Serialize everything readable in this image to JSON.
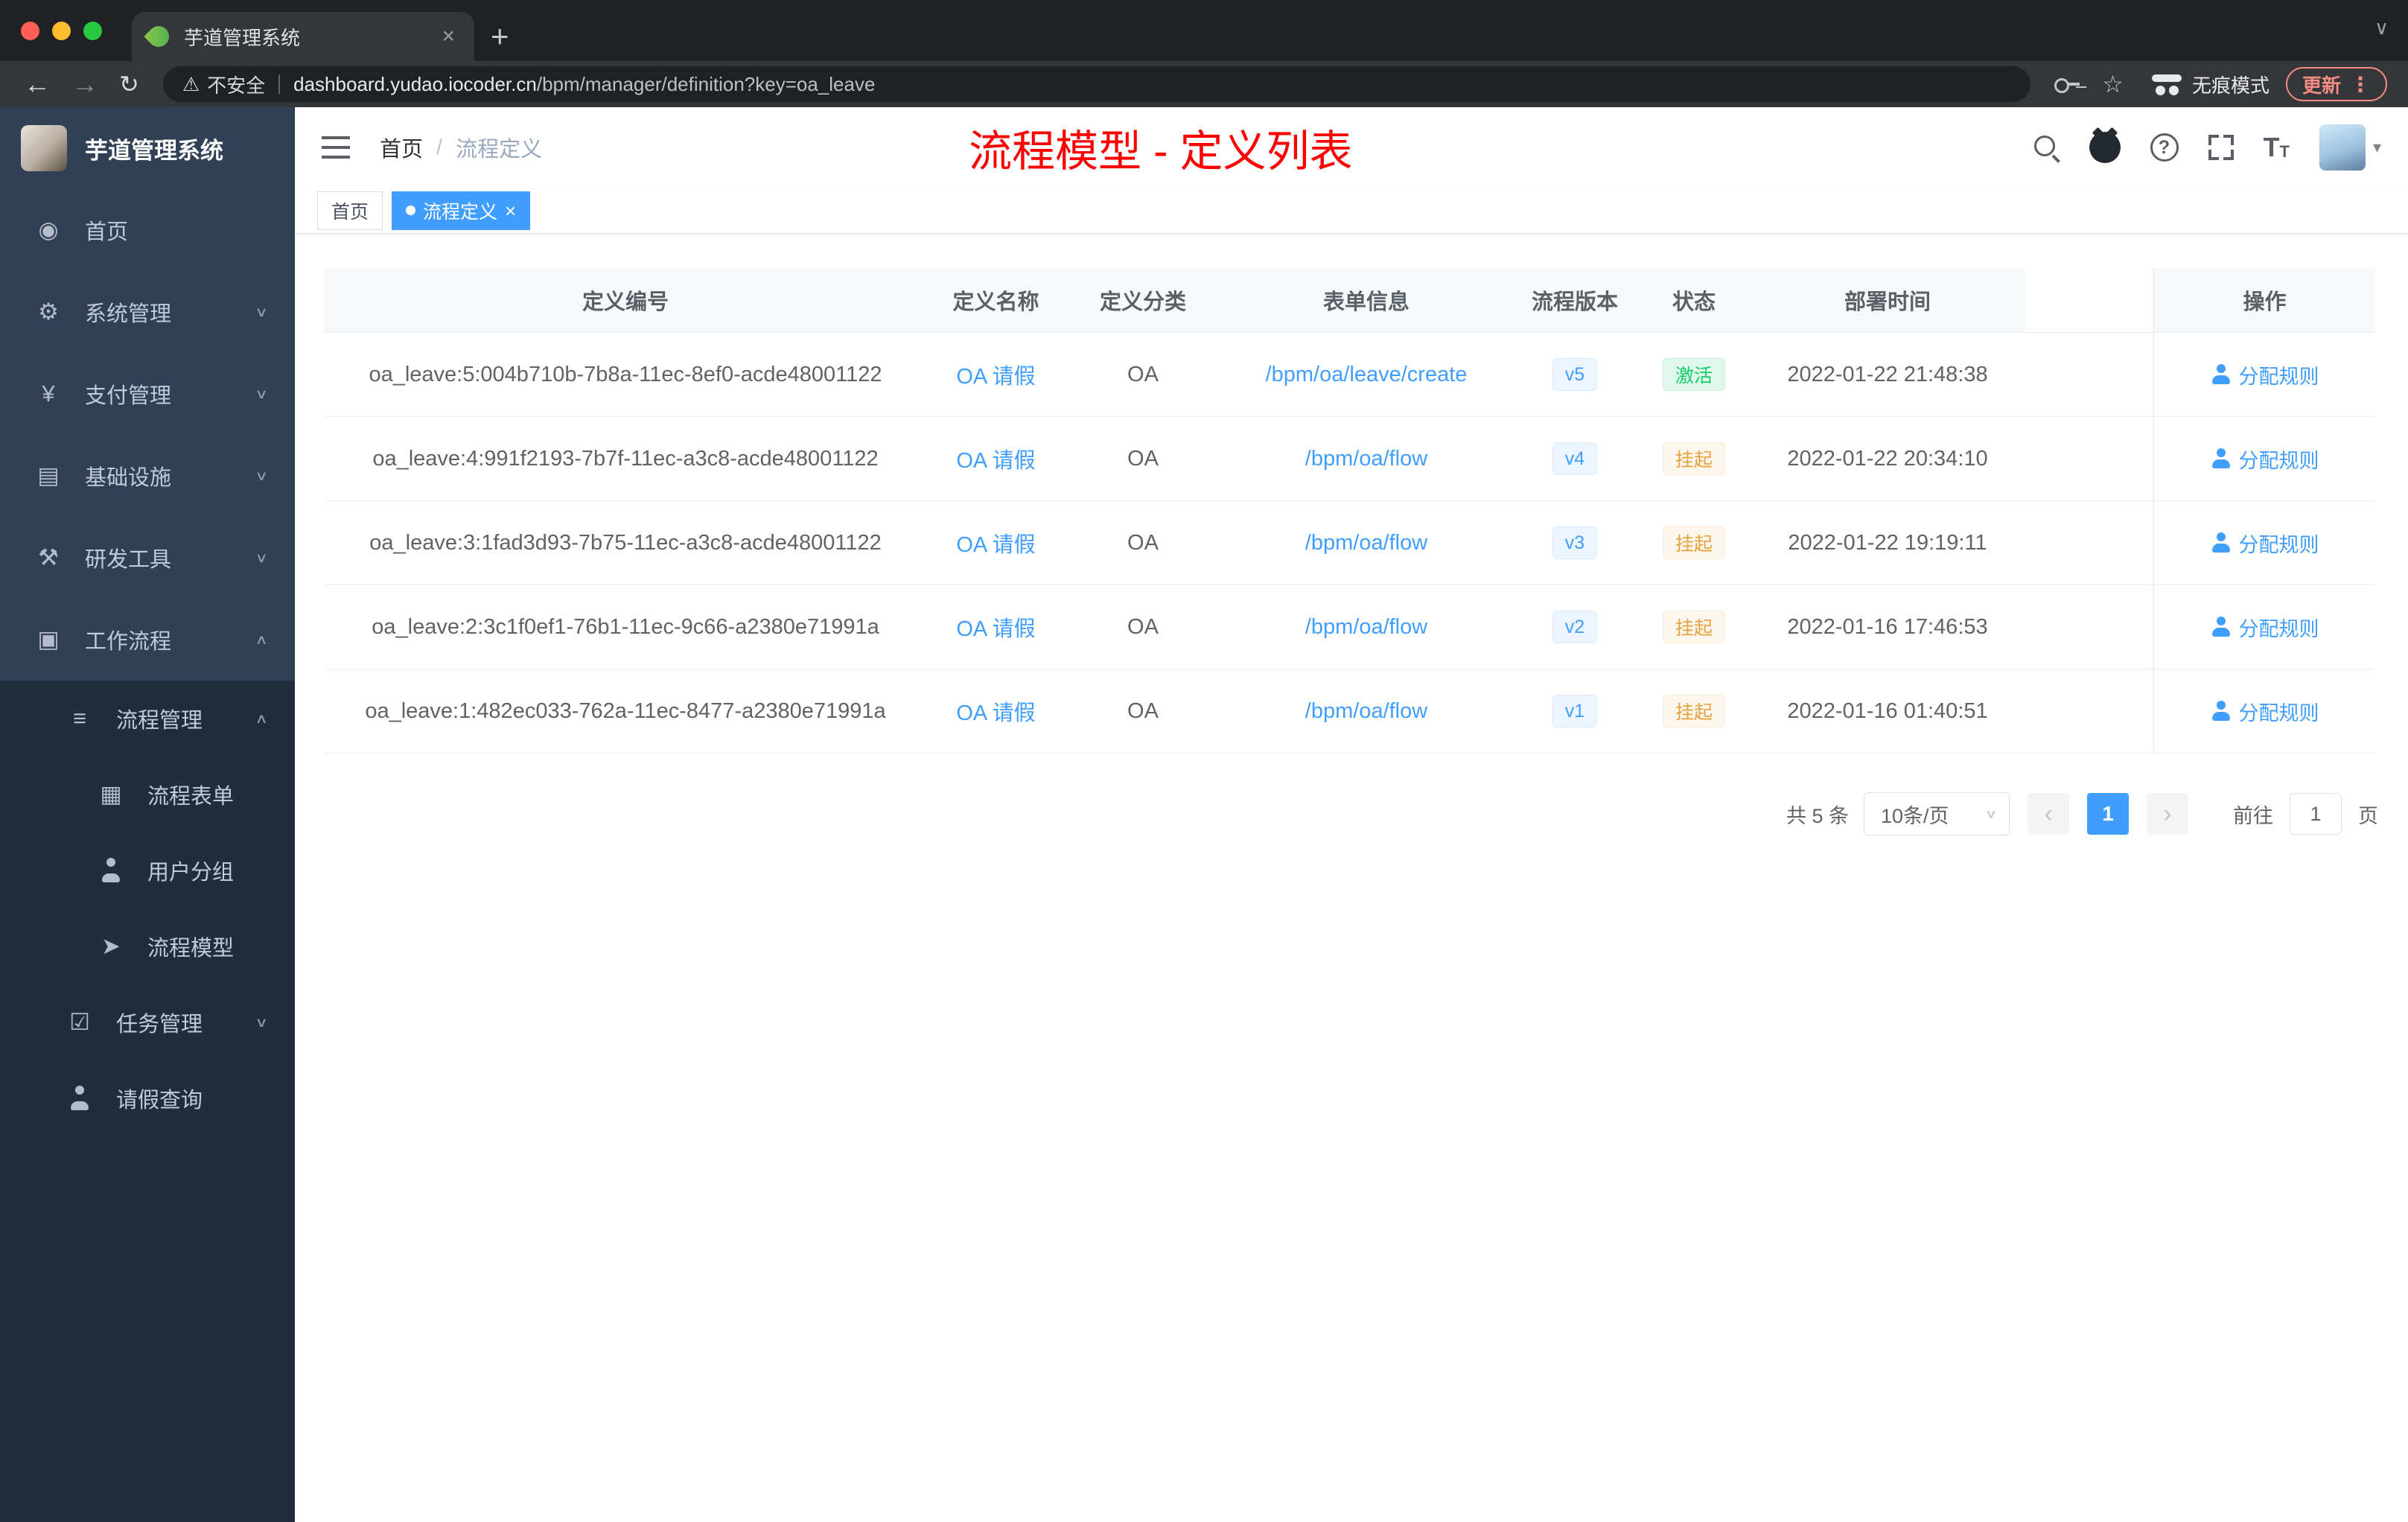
{
  "browser": {
    "tab_title": "芋道管理系统",
    "security_label": "不安全",
    "url_host": "dashboard.yudao.iocoder.cn",
    "url_path": "/bpm/manager/definition?key=oa_leave",
    "incognito_label": "无痕模式",
    "update_label": "更新"
  },
  "sidebar": {
    "logo_title": "芋道管理系统",
    "menu": [
      {
        "label": "首页",
        "icon": "gauge",
        "depth": "d0",
        "shade": "",
        "chevron": ""
      },
      {
        "label": "系统管理",
        "icon": "gear",
        "depth": "d0",
        "shade": "",
        "chevron": "down"
      },
      {
        "label": "支付管理",
        "icon": "yen",
        "depth": "d0",
        "shade": "",
        "chevron": "down"
      },
      {
        "label": "基础设施",
        "icon": "infra",
        "depth": "d0",
        "shade": "",
        "chevron": "down"
      },
      {
        "label": "研发工具",
        "icon": "tools",
        "depth": "d0",
        "shade": "",
        "chevron": "down"
      },
      {
        "label": "工作流程",
        "icon": "workflow",
        "depth": "d0",
        "shade": "",
        "chevron": "up"
      },
      {
        "label": "流程管理",
        "icon": "list",
        "depth": "d1",
        "shade": "dark",
        "chevron": "up"
      },
      {
        "label": "流程表单",
        "icon": "form",
        "depth": "d2",
        "shade": "dark",
        "chevron": ""
      },
      {
        "label": "用户分组",
        "icon": "users",
        "depth": "d2",
        "shade": "dark",
        "chevron": ""
      },
      {
        "label": "流程模型",
        "icon": "send",
        "depth": "d2",
        "shade": "dark",
        "chevron": ""
      },
      {
        "label": "任务管理",
        "icon": "tasks",
        "depth": "d1",
        "shade": "dark",
        "chevron": "down"
      },
      {
        "label": "请假查询",
        "icon": "user",
        "depth": "d1",
        "shade": "dark",
        "chevron": ""
      }
    ]
  },
  "navbar": {
    "breadcrumb": {
      "home": "首页",
      "sep": "/",
      "current": "流程定义"
    },
    "annotation": "流程模型 - 定义列表"
  },
  "tags": [
    {
      "label": "首页",
      "state": ""
    },
    {
      "label": "流程定义",
      "state": "active"
    }
  ],
  "table": {
    "main_columns": [
      {
        "key": "id",
        "label": "定义编号"
      },
      {
        "key": "name",
        "label": "定义名称"
      },
      {
        "key": "category",
        "label": "定义分类"
      },
      {
        "key": "form",
        "label": "表单信息"
      },
      {
        "key": "version",
        "label": "流程版本"
      },
      {
        "key": "status",
        "label": "状态"
      },
      {
        "key": "time",
        "label": "部署时间"
      }
    ],
    "action_column": "操作",
    "rows": [
      {
        "id": "oa_leave:5:004b710b-7b8a-11ec-8ef0-acde48001122",
        "name": "OA 请假",
        "category": "OA",
        "form": "/bpm/oa/leave/create",
        "version": "v5",
        "status": "激活",
        "status_type": "success",
        "deploy_time": "2022-01-22 21:48:38",
        "action": "分配规则"
      },
      {
        "id": "oa_leave:4:991f2193-7b7f-11ec-a3c8-acde48001122",
        "name": "OA 请假",
        "category": "OA",
        "form": "/bpm/oa/flow",
        "version": "v4",
        "status": "挂起",
        "status_type": "warning",
        "deploy_time": "2022-01-22 20:34:10",
        "action": "分配规则"
      },
      {
        "id": "oa_leave:3:1fad3d93-7b75-11ec-a3c8-acde48001122",
        "name": "OA 请假",
        "category": "OA",
        "form": "/bpm/oa/flow",
        "version": "v3",
        "status": "挂起",
        "status_type": "warning",
        "deploy_time": "2022-01-22 19:19:11",
        "action": "分配规则"
      },
      {
        "id": "oa_leave:2:3c1f0ef1-76b1-11ec-9c66-a2380e71991a",
        "name": "OA 请假",
        "category": "OA",
        "form": "/bpm/oa/flow",
        "version": "v2",
        "status": "挂起",
        "status_type": "warning",
        "deploy_time": "2022-01-16 17:46:53",
        "action": "分配规则"
      },
      {
        "id": "oa_leave:1:482ec033-762a-11ec-8477-a2380e71991a",
        "name": "OA 请假",
        "category": "OA",
        "form": "/bpm/oa/flow",
        "version": "v1",
        "status": "挂起",
        "status_type": "warning",
        "deploy_time": "2022-01-16 01:40:51",
        "action": "分配规则"
      }
    ]
  },
  "pagination": {
    "total": "共 5 条",
    "page_size": "10条/页",
    "page": "1",
    "goto_label": "前往",
    "goto_value": "1",
    "goto_unit": "页"
  }
}
